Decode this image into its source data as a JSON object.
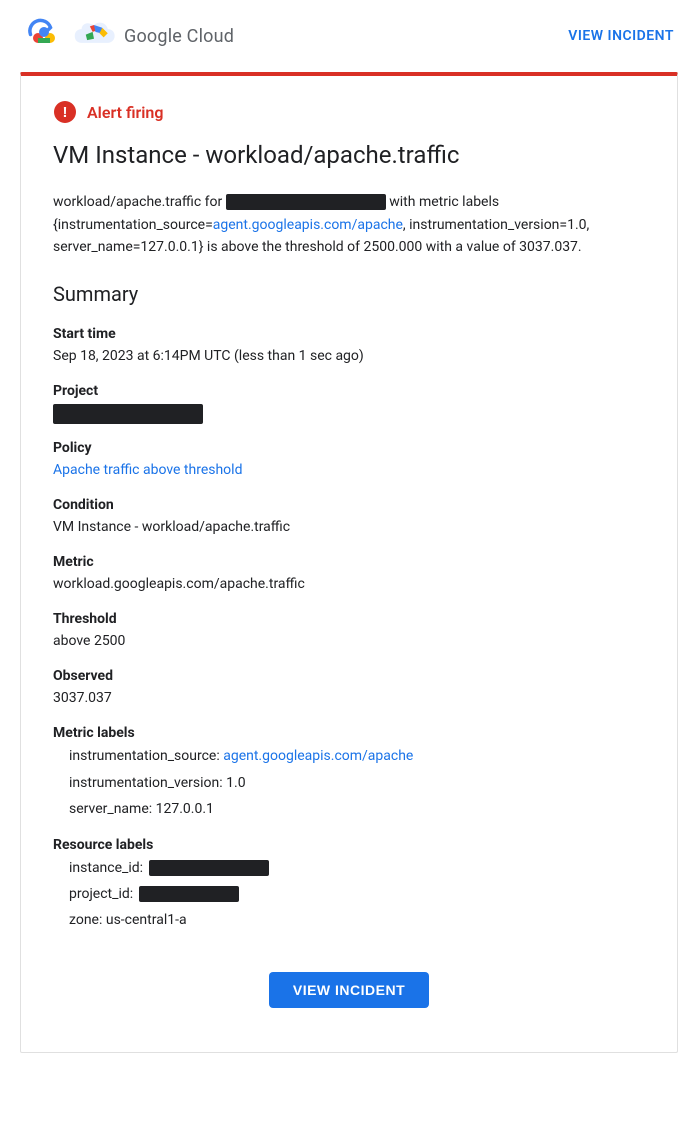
{
  "header": {
    "logo_text": "Google Cloud",
    "view_incident_top": "VIEW INCIDENT"
  },
  "alert": {
    "firing_label": "Alert firing",
    "title": "VM Instance - workload/apache.traffic",
    "description_prefix": "workload/apache.traffic for",
    "description_redacted": true,
    "description_middle": "with metric labels {instrumentation_source=",
    "description_link": "agent.googleapis.com/apache",
    "description_suffix": ", instrumentation_version=1.0, server_name=127.0.0.1} is above the threshold of 2500.000 with a value of 3037.037."
  },
  "summary": {
    "heading": "Summary",
    "start_time_label": "Start time",
    "start_time_value": "Sep 18, 2023 at 6:14PM UTC (less than 1 sec ago)",
    "project_label": "Project",
    "policy_label": "Policy",
    "policy_value": "Apache traffic above threshold",
    "policy_link": "Apache traffic above threshold",
    "condition_label": "Condition",
    "condition_value": "VM Instance - workload/apache.traffic",
    "metric_label": "Metric",
    "metric_value": "workload.googleapis.com/apache.traffic",
    "threshold_label": "Threshold",
    "threshold_value": "above 2500",
    "observed_label": "Observed",
    "observed_value": "3037.037",
    "metric_labels_label": "Metric labels",
    "metric_labels": {
      "instrumentation_source_label": "instrumentation_source:",
      "instrumentation_source_link": "agent.googleapis.com/apache",
      "instrumentation_version_label": "instrumentation_version:",
      "instrumentation_version_value": "1.0",
      "server_name_label": "server_name:",
      "server_name_value": "127.0.0.1"
    },
    "resource_labels_label": "Resource labels",
    "resource_labels": {
      "instance_id_label": "instance_id:",
      "project_id_label": "project_id:",
      "zone_label": "zone:",
      "zone_value": "us-central1-a"
    }
  },
  "button": {
    "view_incident": "VIEW INCIDENT"
  }
}
